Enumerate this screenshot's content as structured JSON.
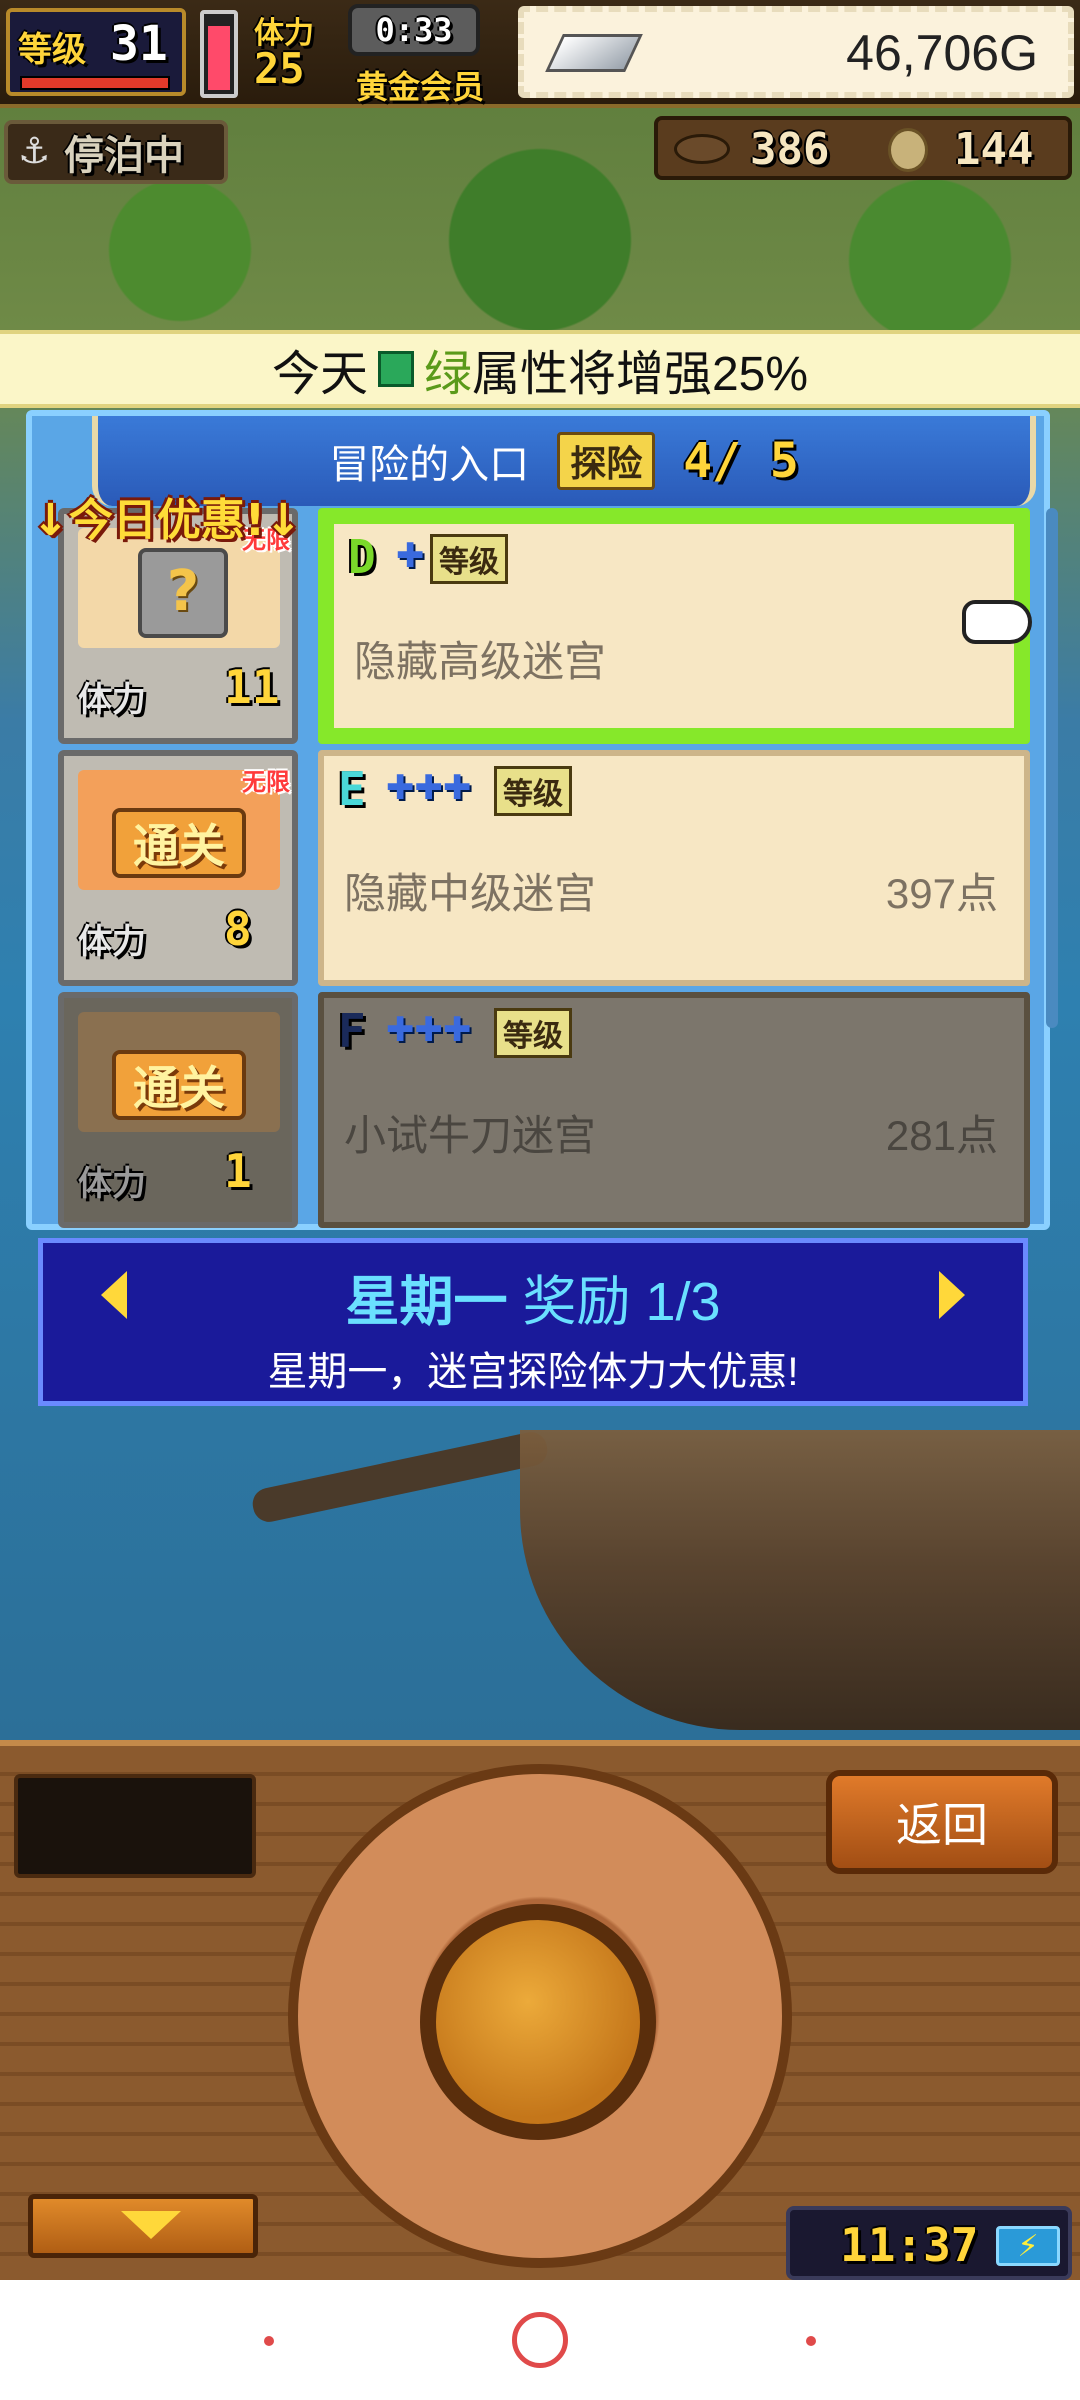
{
  "hud": {
    "level_label": "等级",
    "level_value": "31",
    "stamina_label": "体力",
    "stamina_value": "25",
    "timer": "0:33",
    "membership": "黄金会员",
    "gold": "46,706G",
    "status": "停泊中",
    "fish_count": "386",
    "coin_count": "144"
  },
  "bonus_banner": {
    "prefix": "今天",
    "color_word": "绿",
    "suffix": "属性将增强25%",
    "gem_color": "#2aa85a"
  },
  "dungeon_panel": {
    "title": "冒险的入口",
    "explore_badge": "探险",
    "explore_count": "4/ 5",
    "deal_label": "↓今日优惠!↓",
    "rows": [
      {
        "rank": "D",
        "plus": "✚",
        "level_tag": "等级",
        "name": "隐藏高级迷宫",
        "points": "",
        "stamina_label": "体力",
        "stamina": "11",
        "badge": "无限",
        "card": "?"
      },
      {
        "rank": "E",
        "plus": "✚✚✚",
        "level_tag": "等级",
        "name": "隐藏中级迷宫",
        "points": "397点",
        "stamina_label": "体力",
        "stamina": "8",
        "badge": "无限",
        "card": "通关"
      },
      {
        "rank": "F",
        "plus": "✚✚✚",
        "level_tag": "等级",
        "name": "小试牛刀迷宫",
        "points": "281点",
        "stamina_label": "体力",
        "stamina": "1",
        "badge": "",
        "card": "通关"
      }
    ]
  },
  "daily_reward": {
    "day": "星期一",
    "reward": "奖励 1/3",
    "description": "星期一，迷宫探险体力大优惠!"
  },
  "controls": {
    "back_label": "返回",
    "clock": "11:37",
    "battery_symbol": "⚡"
  },
  "colors": {
    "accent_green": "#86e82a",
    "panel_blue": "#5aa6e6",
    "reward_blue": "#1a1a9a"
  }
}
